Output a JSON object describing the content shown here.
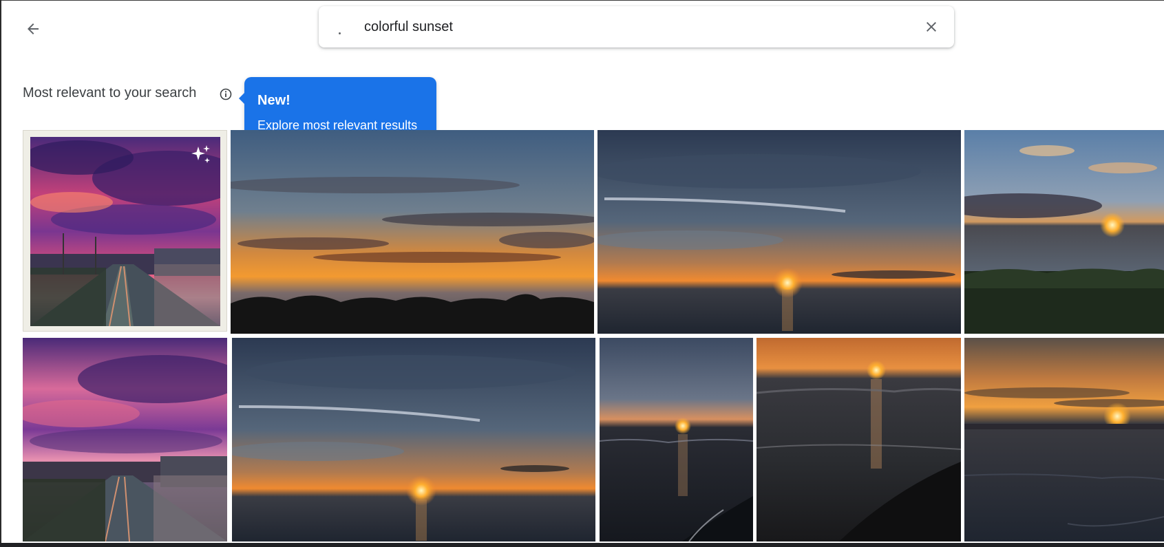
{
  "search": {
    "query": "colorful sunset"
  },
  "section": {
    "heading": "Most relevant to your search"
  },
  "tooltip": {
    "title": "New!",
    "text": "Explore most relevant results"
  },
  "icons": {
    "back": "arrow-back-icon",
    "clear": "close-icon",
    "info": "info-icon",
    "sparkle": "sparkle-icon"
  },
  "colors": {
    "tooltip_background": "#1a73e8",
    "heading_text": "#3c4043"
  }
}
